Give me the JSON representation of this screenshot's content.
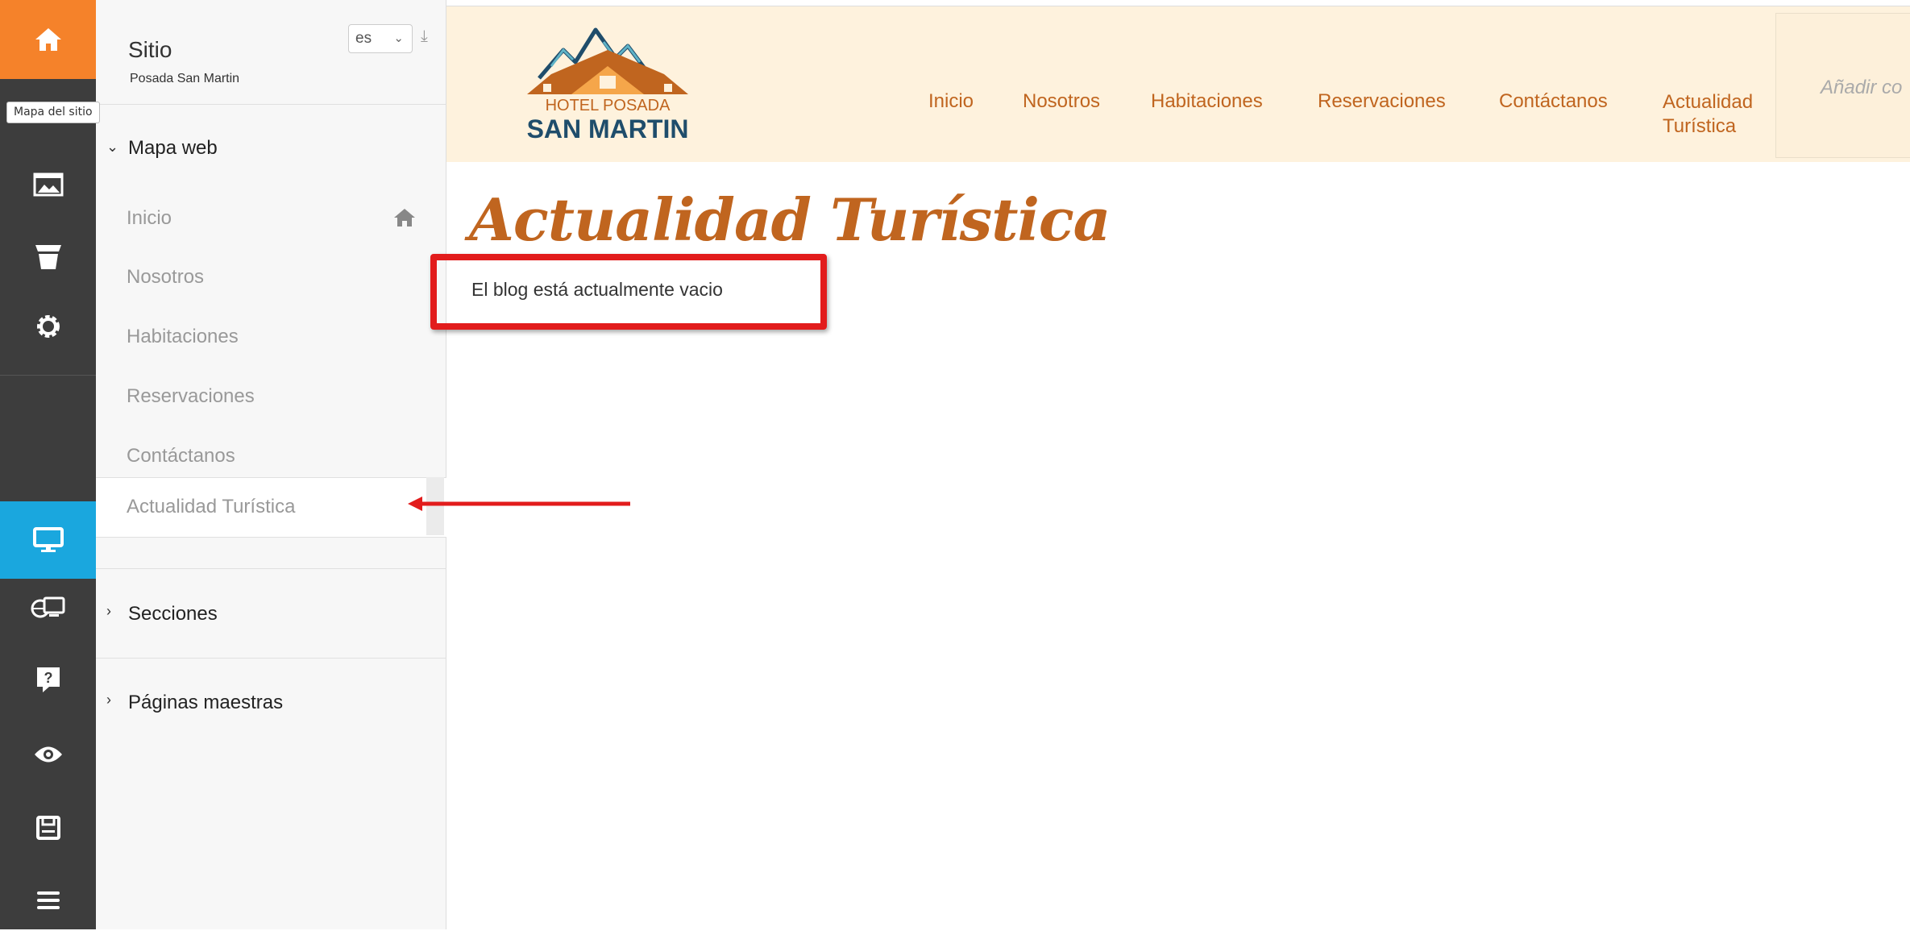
{
  "toolbar": {
    "tooltip": "Mapa del sitio",
    "items": [
      "home-icon",
      "images-icon",
      "store-icon",
      "gear-icon",
      "desktop-icon",
      "web-devices-icon",
      "help-icon",
      "eye-icon",
      "save-icon",
      "menu-icon"
    ],
    "active_color": "#1aa7de",
    "home_color": "#f5822a"
  },
  "panel": {
    "title": "Sitio",
    "subtitle": "Posada San Martin",
    "language": "es",
    "sitemap_label": "Mapa web",
    "pages": [
      "Inicio",
      "Nosotros",
      "Habitaciones",
      "Reservaciones",
      "Contáctanos",
      "Actualidad Turística"
    ],
    "active_page": "Actualidad Turística",
    "sections_label": "Secciones",
    "master_pages_label": "Páginas maestras"
  },
  "site": {
    "logo_line1": "HOTEL POSADA",
    "logo_line2": "SAN MARTIN",
    "nav": [
      "Inicio",
      "Nosotros",
      "Habitaciones",
      "Reservaciones",
      "Contáctanos"
    ],
    "nav_last_line1": "Actualidad",
    "nav_last_line2": "Turística",
    "comment_placeholder": "Añadir co",
    "header_bg": "#fef2dd",
    "accent": "#c0651f"
  },
  "content": {
    "title": "Actualidad Turística",
    "empty_message": "El blog está actualmente vacio",
    "highlight_color": "#e21c1c"
  }
}
